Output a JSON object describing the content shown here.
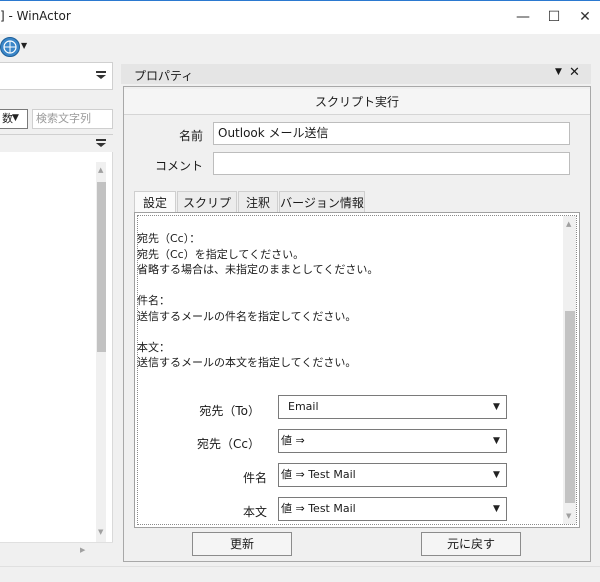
{
  "window": {
    "title": "] - WinActor"
  },
  "window_controls": {
    "minimize": "—",
    "maximize": "☐",
    "close": "✕"
  },
  "left_panel": {
    "dropdown_value": "数",
    "search_placeholder": "検索文字列"
  },
  "properties": {
    "header_title": "プロパティ",
    "section_title": "スクリプト実行",
    "name_label": "名前",
    "name_value": "Outlook メール送信",
    "comment_label": "コメント",
    "comment_value": "",
    "tabs": [
      {
        "label": "設定"
      },
      {
        "label": "スクリプト"
      },
      {
        "label": "注釈"
      },
      {
        "label": "バージョン情報"
      }
    ],
    "description": "宛先（Cc）：\n宛先（Cc）を指定してください。\n省略する場合は、未指定のままとしてください。\n\n件名：\n送信するメールの件名を指定してください。\n\n本文：\n送信するメールの本文を指定してください。",
    "params": [
      {
        "label": "宛先（To）",
        "value": "Email"
      },
      {
        "label": "宛先（Cc）",
        "value": "値 ⇒"
      },
      {
        "label": "件名",
        "value": "値 ⇒  Test Mail"
      },
      {
        "label": "本文",
        "value": "値 ⇒  Test Mail"
      }
    ],
    "update_button": "更新",
    "revert_button": "元に戻す"
  },
  "colors": {
    "accent": "#2b79d0",
    "panel_bg": "#f0f0f0"
  }
}
